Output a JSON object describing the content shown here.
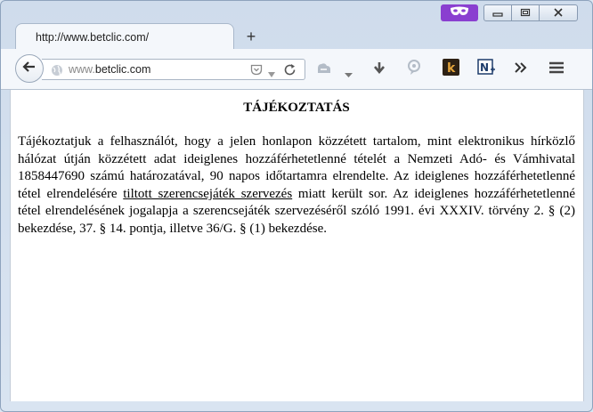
{
  "browser": {
    "tab_title": "http://www.betclic.com/",
    "new_tab_symbol": "+",
    "url_prefix": "www.",
    "url_domain": "betclic.com",
    "private_icon": "mask-icon",
    "colors": {
      "private_accent": "#8a3fd0"
    }
  },
  "page": {
    "heading": "TÁJÉKOZTATÁS",
    "paragraph_start": "Tájékoztatjuk a felhasználót, hogy a jelen honlapon közzétett tartalom, mint elektronikus hírközlő hálózat útján közzétett adat ideiglenes hozzáférhetetlenné tételét a Nemzeti Adó- és Vámhivatal 1858447690 számú határozatával, 90 napos időtartamra elrendelte. Az ideiglenes hozzáférhetetlenné tétel elrendelésére ",
    "paragraph_link": "tiltott szerencsejáték szervezés",
    "paragraph_end": " miatt került sor. Az ideiglenes hozzáférhetetlenné tétel elrendelésének jogalapja a szerencsejáték szervezéséről szóló 1991. évi XXXIV. törvény 2. § (2) bekezdése, 37. § 14. pontja, illetve 36/G. § (1) bekezdése."
  }
}
